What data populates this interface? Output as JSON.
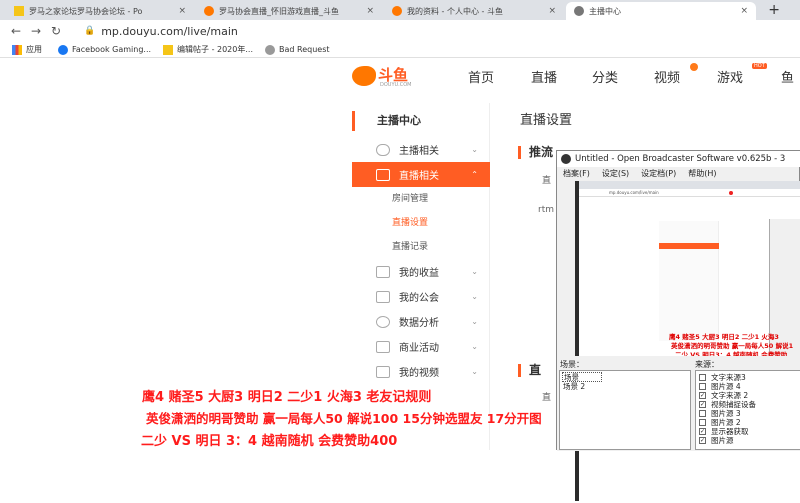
{
  "browser": {
    "tabs": [
      {
        "label": "罗马之家论坛罗马协会论坛 - Po"
      },
      {
        "label": "罗马协会直播_怀旧游戏直播_斗鱼"
      },
      {
        "label": "我的资料 - 个人中心 - 斗鱼"
      },
      {
        "label": "主播中心"
      }
    ],
    "new_tab": "+",
    "close": "×",
    "url": "mp.douyu.com/live/main",
    "bookmarks": [
      {
        "label": "应用"
      },
      {
        "label": "Facebook Gaming..."
      },
      {
        "label": "编辑帖子 - 2020年..."
      },
      {
        "label": "Bad Request"
      }
    ]
  },
  "site": {
    "logo_text": "斗鱼",
    "logo_sub": "DOUYU.COM",
    "nav": [
      {
        "label": "首页"
      },
      {
        "label": "直播"
      },
      {
        "label": "分类"
      },
      {
        "label": "视频"
      },
      {
        "label": "游戏"
      },
      {
        "label": "鱼"
      }
    ],
    "nav_badge": "HOT"
  },
  "sidebar": {
    "title": "主播中心",
    "items": [
      {
        "label": "主播相关"
      },
      {
        "label": "直播相关"
      },
      {
        "label": "我的收益"
      },
      {
        "label": "我的公会"
      },
      {
        "label": "数据分析"
      },
      {
        "label": "商业活动"
      },
      {
        "label": "我的视频"
      }
    ],
    "subitems": [
      {
        "label": "房间管理"
      },
      {
        "label": "直播设置"
      },
      {
        "label": "直播记录"
      }
    ]
  },
  "content": {
    "title": "直播设置",
    "section1": "推流",
    "line1": "直",
    "rtmp": "rtm",
    "section2": "直",
    "line2": "直"
  },
  "obs": {
    "title": "Untitled - Open Broadcaster Software v0.625b - 3",
    "menu": [
      {
        "label": "档案(F)"
      },
      {
        "label": "设定(S)"
      },
      {
        "label": "设定档(P)"
      },
      {
        "label": "帮助(H)"
      }
    ],
    "preview_url": "mp.douyu.com/live/main",
    "scenes_label": "场景：",
    "scenes": [
      {
        "label": "场景"
      },
      {
        "label": "场景 2"
      }
    ],
    "sources_label": "来源：",
    "sources": [
      {
        "label": "文字来源3",
        "checked": false
      },
      {
        "label": "图片源 4",
        "checked": false
      },
      {
        "label": "文字来源 2",
        "checked": true
      },
      {
        "label": "视频捕捉设备",
        "checked": true
      },
      {
        "label": "图片源 3",
        "checked": false
      },
      {
        "label": "图片源 2",
        "checked": false
      },
      {
        "label": "显示器获取",
        "checked": true
      },
      {
        "label": "图片源",
        "checked": true
      }
    ],
    "mini_captions": [
      "鹰4 赌圣5 大厨3 明日2 二少1 火海3",
      "英俊潇洒的明哥赞助 赢一局每人50 解说1",
      "二少 VS 明日3：4 越南随机 会费赞助"
    ]
  },
  "overlay": {
    "line1": "鹰4  赌圣5  大厨3  明日2  二少1  火海3  老友记规则",
    "line2": "英俊潇洒的明哥赞助 赢一局每人50 解说100  15分钟选盟友 17分开图",
    "line3": "二少  VS  明日 3：4  越南随机 会费赞助400"
  },
  "colors": {
    "accent": "#ff5d23",
    "caption": "#ff1c1c"
  }
}
